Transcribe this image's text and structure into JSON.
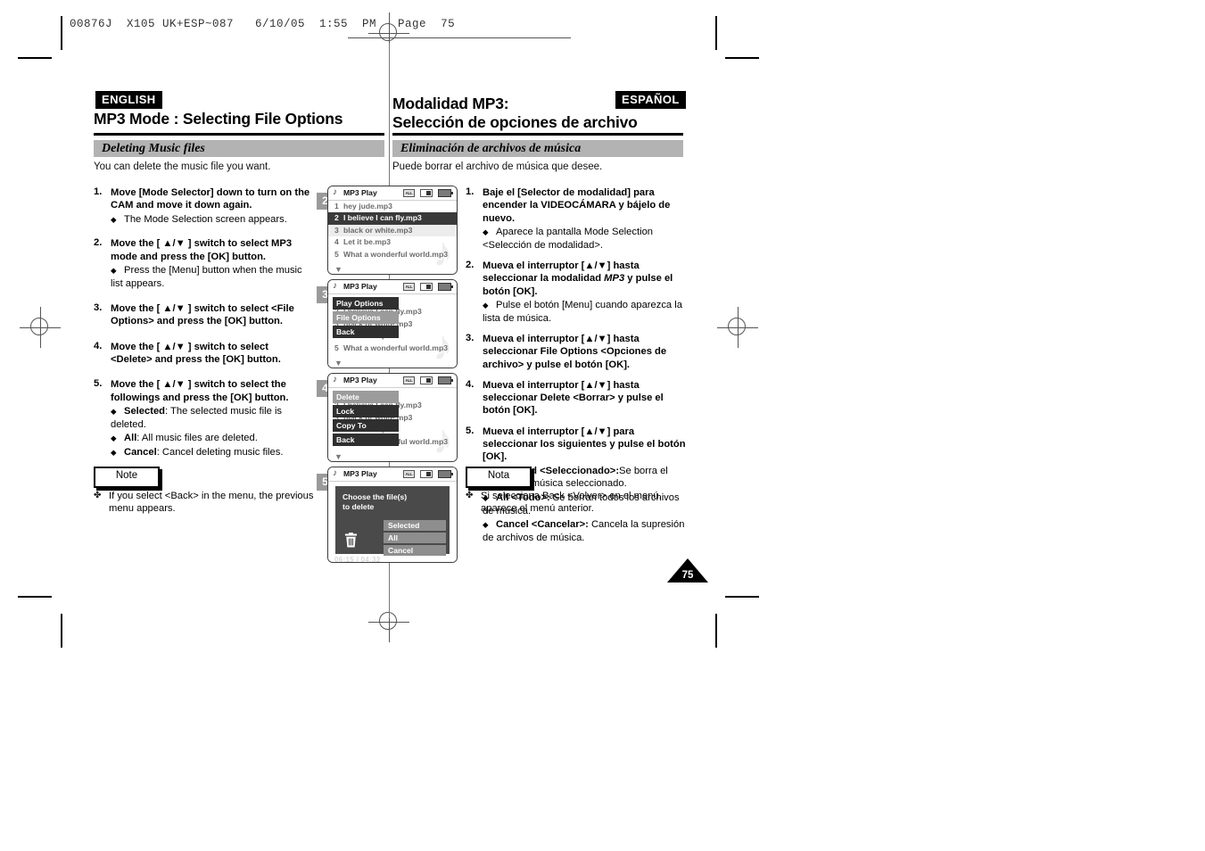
{
  "slug": {
    "text": "00876J  X105 UK+ESP~087   6/10/05  1:55  PM   Page  75"
  },
  "english": {
    "tag": "ENGLISH",
    "title_line1": "MP3 Mode : Selecting File Options",
    "section": "Deleting Music files",
    "intro": "You can delete the music file you want.",
    "steps": [
      {
        "num": "1.",
        "text": "Move [Mode Selector] down to turn on the CAM and move it down again.",
        "subs": [
          {
            "marker": "◆",
            "text": "The Mode Selection screen appears."
          }
        ]
      },
      {
        "num": "2.",
        "text": "Move the [ ▲/▼ ] switch to select MP3 mode and press the [OK] button.",
        "subs": [
          {
            "marker": "◆",
            "text": "Press the [Menu] button when the music list appears."
          }
        ]
      },
      {
        "num": "3.",
        "text": "Move the [ ▲/▼ ] switch to select <File Options> and press the [OK] button.",
        "subs": []
      },
      {
        "num": "4.",
        "text": "Move the [ ▲/▼ ] switch to select <Delete> and press the [OK] button.",
        "subs": []
      },
      {
        "num": "5.",
        "text": "Move the [ ▲/▼ ] switch to select the followings and press the [OK] button.",
        "subs": [
          {
            "marker": "◆",
            "bold": "Selected",
            "text": ": The selected music file is deleted."
          },
          {
            "marker": "◆",
            "bold": "All",
            "text": ": All music files are deleted."
          },
          {
            "marker": "◆",
            "bold": "Cancel",
            "text": ": Cancel deleting music files."
          }
        ]
      }
    ],
    "note_label": "Note",
    "note_marker": "✤",
    "note_text": "If you select <Back> in the menu, the previous menu appears."
  },
  "spanish": {
    "tag": "ESPAÑOL",
    "title_line1": "Modalidad MP3:",
    "title_line2": "Selección de opciones de archivo",
    "section": "Eliminación de archivos de música",
    "intro": "Puede borrar el archivo de música que desee.",
    "steps": [
      {
        "num": "1.",
        "text": "Baje el [Selector de modalidad] para encender la VIDEOCÁMARA y bájelo de nuevo.",
        "subs": [
          {
            "marker": "◆",
            "text": "Aparece la pantalla Mode Selection <Selección de modalidad>."
          }
        ]
      },
      {
        "num": "2.",
        "text_pre": "Mueva el interruptor [▲/▼] hasta seleccionar la modalidad ",
        "text_it": "MP3",
        "text_post": " y pulse el botón [OK].",
        "subs": [
          {
            "marker": "◆",
            "text": "Pulse el botón [Menu] cuando aparezca la lista de música."
          }
        ]
      },
      {
        "num": "3.",
        "text": "Mueva el interruptor [▲/▼] hasta seleccionar File Options <Opciones de archivo> y pulse el botón [OK].",
        "subs": []
      },
      {
        "num": "4.",
        "text": "Mueva el interruptor [▲/▼] hasta seleccionar Delete <Borrar> y pulse el botón [OK].",
        "subs": []
      },
      {
        "num": "5.",
        "text": "Mueva el interruptor [▲/▼] para seleccionar los siguientes y pulse el botón [OK].",
        "subs": [
          {
            "marker": "◆",
            "bold": "Selected <Seleccionado>:",
            "text": "Se borra el archivo de música seleccionado."
          },
          {
            "marker": "◆",
            "bold": "All <Todo>:",
            "text": " Se borran todos los archivos de música."
          },
          {
            "marker": "◆",
            "bold": "Cancel <Cancelar>:",
            "text": " Cancela la supresión de archivos de música."
          }
        ]
      }
    ],
    "note_label": "Nota",
    "note_marker": "✤",
    "note_text": "Si selecciona Back <Volver> en el menú, aparece el menú anterior."
  },
  "lcd": {
    "title": "MP3 Play",
    "note_icon": "♪",
    "icons": {
      "repeat": "ALL",
      "card": "card-icon",
      "battery": "battery-icon"
    },
    "tracks": [
      {
        "idx": "1",
        "name": "hey jude.mp3"
      },
      {
        "idx": "2",
        "name": "I believe I can fly.mp3"
      },
      {
        "idx": "3",
        "name": "black or white.mp3"
      },
      {
        "idx": "4",
        "name": "Let it be.mp3"
      },
      {
        "idx": "5",
        "name": "What a wonderful world.mp3"
      }
    ],
    "screen2": {
      "step": "2",
      "selected_index": 1
    },
    "screen3": {
      "step": "3",
      "menu": [
        {
          "label": "Play Options",
          "highlight": false
        },
        {
          "label": "File Options",
          "highlight": true
        },
        {
          "label": "Back",
          "highlight": false
        }
      ]
    },
    "screen4": {
      "step": "4",
      "menu": [
        {
          "label": "Delete",
          "highlight": true
        },
        {
          "label": "Lock",
          "highlight": false
        },
        {
          "label": "Copy To",
          "highlight": false
        },
        {
          "label": "Back",
          "highlight": false
        }
      ]
    },
    "screen5": {
      "step": "5",
      "prompt_line1": "Choose the file(s)",
      "prompt_line2": "to delete",
      "options": [
        {
          "label": "Selected"
        },
        {
          "label": "All"
        },
        {
          "label": "Cancel"
        }
      ],
      "timestamp": "06:15 / 04:32"
    }
  },
  "page_number": "75"
}
